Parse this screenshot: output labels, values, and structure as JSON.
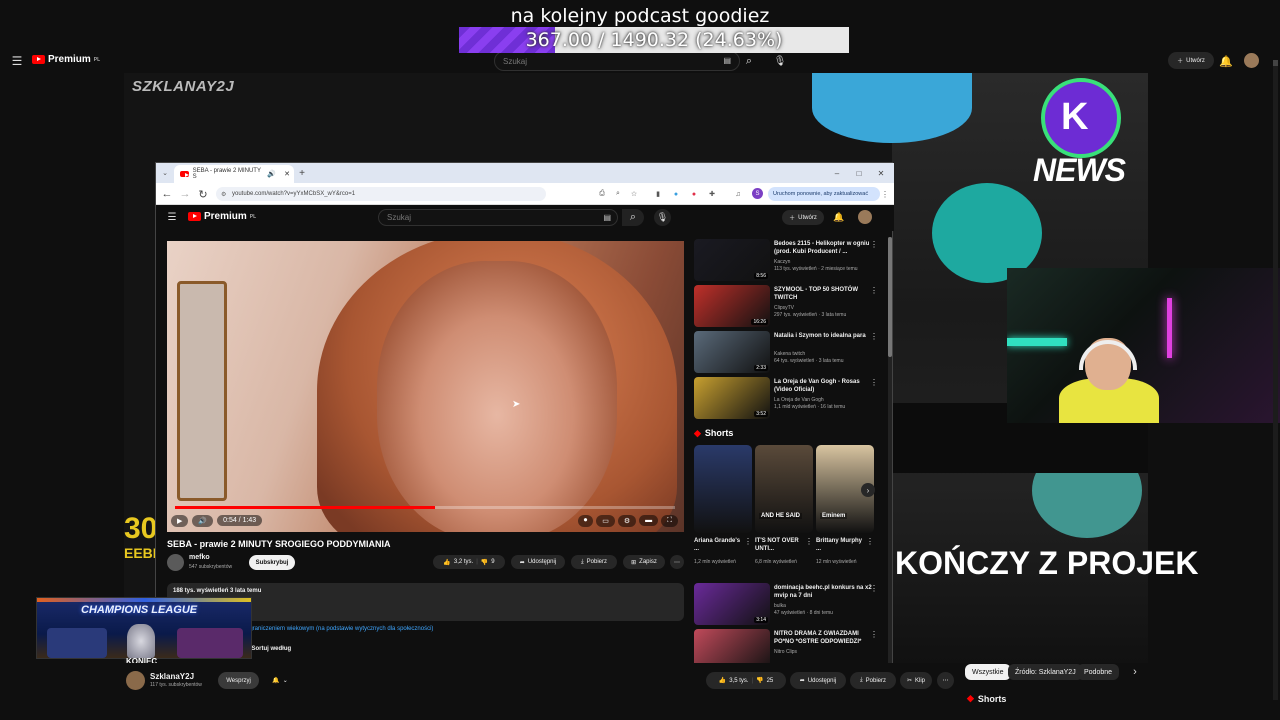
{
  "goal": {
    "title": "na kolejny podcast goodiez",
    "progress_text": "367.00 / 1490.32 (24.63%)",
    "progress_fraction": 0.2463
  },
  "outer_header": {
    "logo": "Premium",
    "logo_sup": "PL",
    "search_placeholder": "Szukaj",
    "create_label": "Utwórz"
  },
  "stream": {
    "channel_logo": "SZKLANAY2J",
    "news_badge": "NEWS",
    "konczy_text": "KOŃCZY Z PROJEK",
    "left_banner": "30",
    "left_banner_sub": "EEBE"
  },
  "browser": {
    "tab_title": "SEBA - prawie 2 MINUTY S",
    "url": "youtube.com/watch?v=yYxMCbSX_wY&rco=1",
    "update_notice": "Uruchom ponownie, aby zaktualizować",
    "profile_initial": "S",
    "yt_logo": "Premium",
    "yt_logo_sup": "PL",
    "search_placeholder": "Szukaj",
    "create_label": "Utwórz",
    "player": {
      "time": "0:54 / 1:43",
      "progress_fraction": 0.52
    },
    "video_title": "SEBA - prawie 2 MINUTY SROGIEGO PODDYMIANIA",
    "channel_name": "mefko",
    "subscribers": "547 subskrybentów",
    "subscribe_label": "Subskrybuj",
    "likes": "3,2 tys.",
    "dislikes": "9",
    "share_label": "Udostępnij",
    "download_label": "Pobierz",
    "save_label": "Zapisz",
    "desc_stats": "188 tys. wyświetleń  3 lata temu",
    "age_notice": "ograniczeniem wiekowym (na podstawie wytycznych dla społeczności)",
    "sort_label": "Sortuj według",
    "recs": [
      {
        "title": "Bedoes 2115 - Helikopter w ogniu (prod. Kubi Producent / ...",
        "channel": "Kaczyn",
        "meta": "113 tys. wyświetleń · 2 miesiące temu",
        "duration": "8:56",
        "color": "#1a1a22"
      },
      {
        "title": "SZYMOOL - TOP 50 SHOTÓW TWITCH",
        "channel": "ClipsyTV",
        "meta": "297 tys. wyświetleń · 3 lata temu",
        "duration": "16:26",
        "color": "#c0302a"
      },
      {
        "title": "Natalia i Szymon to idealna para",
        "channel": "Kakena twitch",
        "meta": "64 tys. wyświetleń · 3 lata temu",
        "duration": "2:33",
        "color": "#5a6a7a"
      },
      {
        "title": "La Oreja de Van Gogh - Rosas (Video Oficial)",
        "channel": "La Oreja de Van Gogh",
        "meta": "1,1 mld wyświetleń · 16 lat temu",
        "duration": "3:52",
        "color": "#c8a030"
      }
    ],
    "shorts_label": "Shorts",
    "shorts": [
      {
        "title": "Ariana Grande's ...",
        "views": "1,2 mln wyświetleń",
        "color": "#2a3a6a"
      },
      {
        "title": "IT'S NOT OVER UNTI...",
        "views": "6,8 mln wyświetleń",
        "color": "#5a4a3a",
        "overlay": "AND HE SAID"
      },
      {
        "title": "Brittany Murphy ...",
        "views": "12 mln wyświetleń",
        "color": "#d8c4a0",
        "overlay": "Eminem"
      }
    ],
    "recs2": [
      {
        "title": "dominacja beehc.pl konkurs na x2 mvip na 7 dni",
        "channel": "bulka",
        "meta": "47 wyświetleń · 8 dni temu",
        "duration": "3:14",
        "color": "#6a2a9a"
      },
      {
        "title": "NITRO DRAMA Z GWIAZDAMI PO*NO *OSTRE ODPOWIEDZI*",
        "channel": "Nitro Clips",
        "meta": "",
        "duration": "",
        "color": "#c04a5a"
      }
    ]
  },
  "outer_bottom": {
    "channel": "SzklanaY2J",
    "subscribers": "117 tys. subskrybentów",
    "support_label": "Wesprzyj",
    "likes": "3,5 tys.",
    "dislikes": "25",
    "share_label": "Udostępnij",
    "download_label": "Pobierz",
    "clip_label": "Klip",
    "chips": [
      "Wszystkie",
      "Źródło: SzklanaY2J",
      "Podobne"
    ],
    "shorts_label": "Shorts",
    "konie_text": "KONIEC",
    "champions_text": "CHAMPIONS LEAGUE"
  }
}
